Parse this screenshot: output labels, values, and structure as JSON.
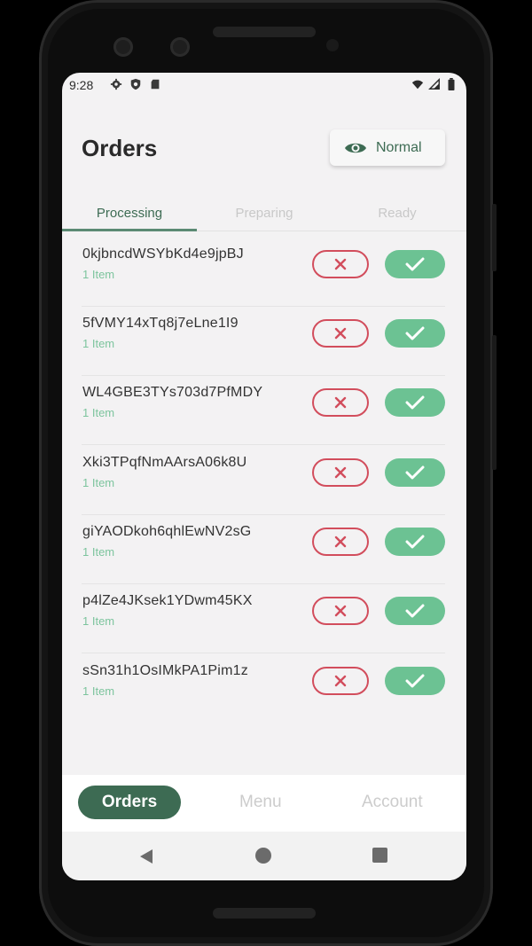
{
  "status_bar": {
    "time": "9:28",
    "left_icons": [
      "gear-icon",
      "shield-icon",
      "sd-card-icon"
    ],
    "right_icons": [
      "wifi-icon",
      "signal-icon",
      "battery-icon"
    ]
  },
  "header": {
    "title": "Orders",
    "mode_button": {
      "label": "Normal",
      "icon": "eye-icon"
    }
  },
  "tabs": [
    {
      "label": "Processing",
      "active": true
    },
    {
      "label": "Preparing",
      "active": false
    },
    {
      "label": "Ready",
      "active": false
    }
  ],
  "orders": [
    {
      "id": "0kjbncdWSYbKd4e9jpBJ",
      "count": "1 Item"
    },
    {
      "id": "5fVMY14xTq8j7eLne1I9",
      "count": "1 Item"
    },
    {
      "id": "WL4GBE3TYs703d7PfMDY",
      "count": "1 Item"
    },
    {
      "id": "Xki3TPqfNmAArsA06k8U",
      "count": "1 Item"
    },
    {
      "id": "giYAODkoh6qhlEwNV2sG",
      "count": "1 Item"
    },
    {
      "id": "p4lZe4JKsek1YDwm45KX",
      "count": "1 Item"
    },
    {
      "id": "sSn31h1OsIMkPA1Pim1z",
      "count": "1 Item"
    }
  ],
  "bottom_nav": {
    "active": "Orders",
    "items": [
      "Menu",
      "Account"
    ]
  },
  "colors": {
    "primary": "#3d6b53",
    "accept": "#6cc293",
    "reject": "#d24d5c",
    "item_count": "#7cc49d"
  }
}
